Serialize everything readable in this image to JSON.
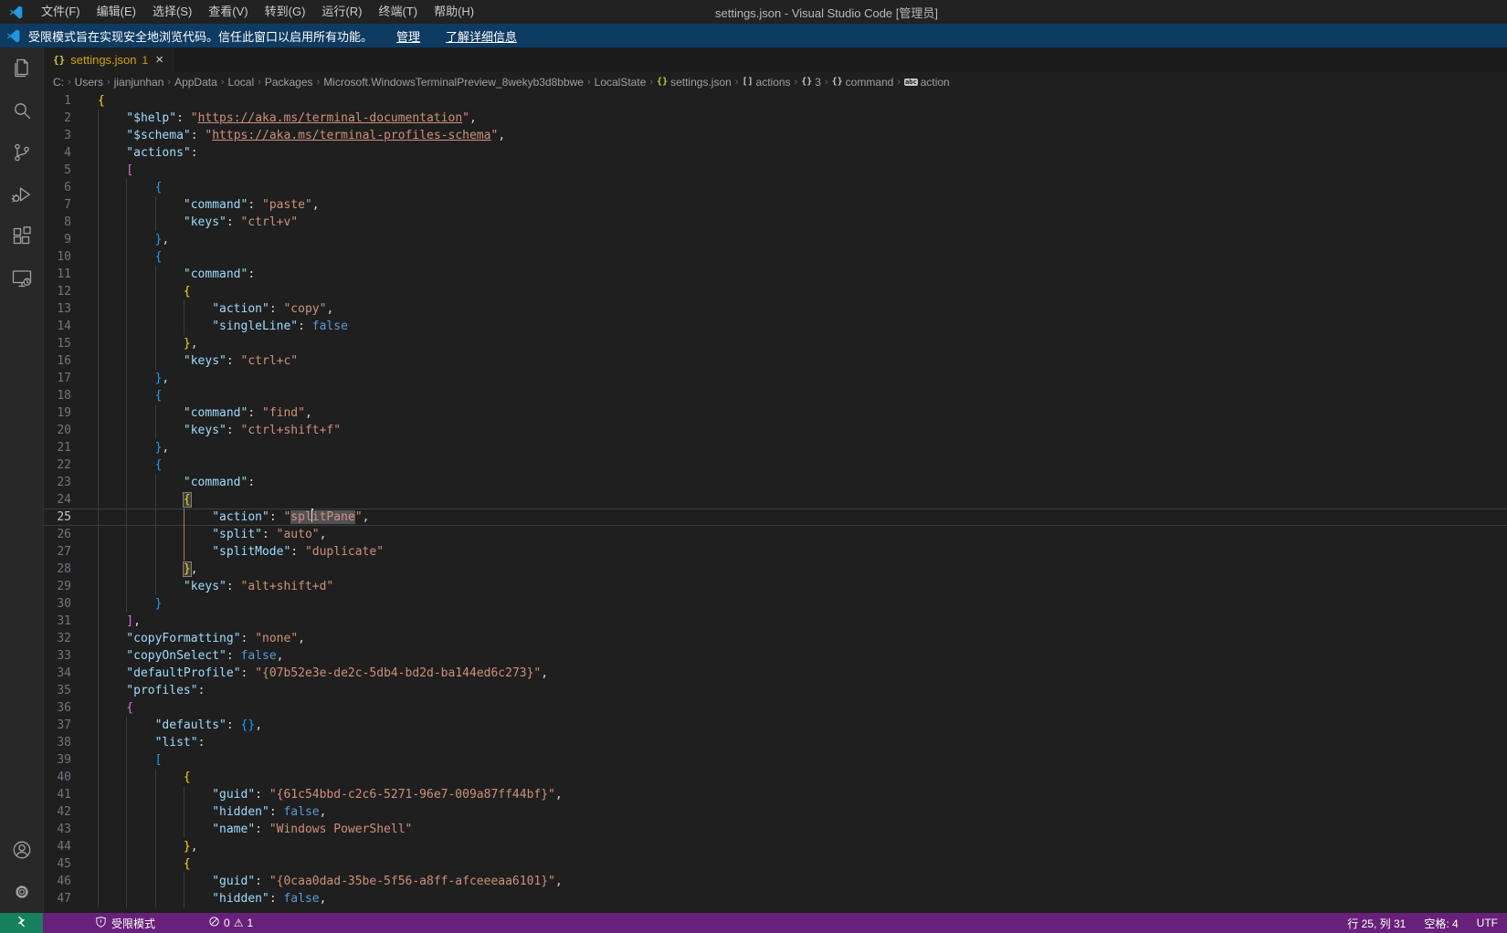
{
  "window": {
    "title": "settings.json - Visual Studio Code [管理员]"
  },
  "menus": [
    {
      "name": "file",
      "label": "文件(F)"
    },
    {
      "name": "edit",
      "label": "编辑(E)"
    },
    {
      "name": "selection",
      "label": "选择(S)"
    },
    {
      "name": "view",
      "label": "查看(V)"
    },
    {
      "name": "go",
      "label": "转到(G)"
    },
    {
      "name": "run",
      "label": "运行(R)"
    },
    {
      "name": "terminal",
      "label": "终端(T)"
    },
    {
      "name": "help",
      "label": "帮助(H)"
    }
  ],
  "banner": {
    "message": "受限模式旨在实现安全地浏览代码。信任此窗口以启用所有功能。",
    "manage_label": "管理",
    "learn_more_label": "了解详细信息"
  },
  "tab": {
    "icon_text": "{}",
    "label": "settings.json",
    "warning_badge": "1",
    "close_glyph": "×"
  },
  "breadcrumb": {
    "items": [
      {
        "label": "C:"
      },
      {
        "label": "Users"
      },
      {
        "label": "jianjunhan"
      },
      {
        "label": "AppData"
      },
      {
        "label": "Local"
      },
      {
        "label": "Packages"
      },
      {
        "label": "Microsoft.WindowsTerminalPreview_8wekyb3d8bbwe"
      },
      {
        "label": "LocalState"
      },
      {
        "label": "settings.json",
        "icon": "json-file-icon",
        "icon_text": "{}",
        "icon_class": "ic-gold"
      },
      {
        "label": "actions",
        "icon": "array-symbol-icon",
        "icon_text": "[]",
        "icon_class": "ic-gray"
      },
      {
        "label": "3",
        "icon": "object-symbol-icon",
        "icon_text": "{}",
        "icon_class": "ic-gray"
      },
      {
        "label": "command",
        "icon": "object-symbol-icon",
        "icon_text": "{}",
        "icon_class": "ic-gray"
      },
      {
        "label": "action",
        "icon": "string-symbol-icon",
        "icon_text": "abc",
        "icon_class": "ic-abc"
      }
    ]
  },
  "activity_bar": {
    "top": [
      {
        "name": "explorer"
      },
      {
        "name": "search"
      },
      {
        "name": "source-control"
      },
      {
        "name": "run-debug"
      },
      {
        "name": "extensions"
      },
      {
        "name": "remote-explorer"
      }
    ],
    "bottom": [
      {
        "name": "account"
      },
      {
        "name": "settings"
      }
    ]
  },
  "editor": {
    "cursor": {
      "line": 25,
      "col": 31
    },
    "lines": [
      {
        "n": 1,
        "t": [
          [
            "{",
            "b1"
          ]
        ]
      },
      {
        "n": 2,
        "t": [
          [
            "    ",
            ""
          ],
          [
            "\"$help\"",
            "key"
          ],
          [
            ":",
            "pn"
          ],
          [
            " ",
            ""
          ],
          [
            "\"",
            "str"
          ],
          [
            "https://aka.ms/terminal-documentation",
            "str lnk"
          ],
          [
            "\"",
            "str"
          ],
          [
            ",",
            "pn"
          ]
        ]
      },
      {
        "n": 3,
        "t": [
          [
            "    ",
            ""
          ],
          [
            "\"$schema\"",
            "key"
          ],
          [
            ":",
            "pn"
          ],
          [
            " ",
            ""
          ],
          [
            "\"",
            "str"
          ],
          [
            "https://aka.ms/terminal-profiles-schema",
            "str lnk"
          ],
          [
            "\"",
            "str"
          ],
          [
            ",",
            "pn"
          ]
        ]
      },
      {
        "n": 4,
        "t": [
          [
            "    ",
            ""
          ],
          [
            "\"actions\"",
            "key"
          ],
          [
            ":",
            "pn"
          ]
        ]
      },
      {
        "n": 5,
        "t": [
          [
            "    ",
            ""
          ],
          [
            "[",
            "b2"
          ]
        ]
      },
      {
        "n": 6,
        "t": [
          [
            "        ",
            ""
          ],
          [
            "{",
            "b3"
          ]
        ]
      },
      {
        "n": 7,
        "t": [
          [
            "            ",
            ""
          ],
          [
            "\"command\"",
            "key"
          ],
          [
            ":",
            "pn"
          ],
          [
            " ",
            ""
          ],
          [
            "\"paste\"",
            "str"
          ],
          [
            ",",
            "pn"
          ]
        ]
      },
      {
        "n": 8,
        "t": [
          [
            "            ",
            ""
          ],
          [
            "\"keys\"",
            "key"
          ],
          [
            ":",
            "pn"
          ],
          [
            " ",
            ""
          ],
          [
            "\"ctrl+v\"",
            "str"
          ]
        ]
      },
      {
        "n": 9,
        "t": [
          [
            "        ",
            ""
          ],
          [
            "}",
            "b3"
          ],
          [
            ",",
            "pn"
          ]
        ]
      },
      {
        "n": 10,
        "t": [
          [
            "        ",
            ""
          ],
          [
            "{",
            "b3"
          ]
        ]
      },
      {
        "n": 11,
        "t": [
          [
            "            ",
            ""
          ],
          [
            "\"command\"",
            "key"
          ],
          [
            ":",
            "pn"
          ]
        ]
      },
      {
        "n": 12,
        "t": [
          [
            "            ",
            ""
          ],
          [
            "{",
            "b1"
          ]
        ]
      },
      {
        "n": 13,
        "t": [
          [
            "                ",
            ""
          ],
          [
            "\"action\"",
            "key"
          ],
          [
            ":",
            "pn"
          ],
          [
            " ",
            ""
          ],
          [
            "\"copy\"",
            "str"
          ],
          [
            ",",
            "pn"
          ]
        ]
      },
      {
        "n": 14,
        "t": [
          [
            "                ",
            ""
          ],
          [
            "\"singleLine\"",
            "key"
          ],
          [
            ":",
            "pn"
          ],
          [
            " ",
            ""
          ],
          [
            "false",
            "kw"
          ]
        ]
      },
      {
        "n": 15,
        "t": [
          [
            "            ",
            ""
          ],
          [
            "}",
            "b1"
          ],
          [
            ",",
            "pn"
          ]
        ]
      },
      {
        "n": 16,
        "t": [
          [
            "            ",
            ""
          ],
          [
            "\"keys\"",
            "key"
          ],
          [
            ":",
            "pn"
          ],
          [
            " ",
            ""
          ],
          [
            "\"ctrl+c\"",
            "str"
          ]
        ]
      },
      {
        "n": 17,
        "t": [
          [
            "        ",
            ""
          ],
          [
            "}",
            "b3"
          ],
          [
            ",",
            "pn"
          ]
        ]
      },
      {
        "n": 18,
        "t": [
          [
            "        ",
            ""
          ],
          [
            "{",
            "b3"
          ]
        ]
      },
      {
        "n": 19,
        "t": [
          [
            "            ",
            ""
          ],
          [
            "\"command\"",
            "key"
          ],
          [
            ":",
            "pn"
          ],
          [
            " ",
            ""
          ],
          [
            "\"find\"",
            "str"
          ],
          [
            ",",
            "pn"
          ]
        ]
      },
      {
        "n": 20,
        "t": [
          [
            "            ",
            ""
          ],
          [
            "\"keys\"",
            "key"
          ],
          [
            ":",
            "pn"
          ],
          [
            " ",
            ""
          ],
          [
            "\"ctrl+shift+f\"",
            "str"
          ]
        ]
      },
      {
        "n": 21,
        "t": [
          [
            "        ",
            ""
          ],
          [
            "}",
            "b3"
          ],
          [
            ",",
            "pn"
          ]
        ]
      },
      {
        "n": 22,
        "t": [
          [
            "        ",
            ""
          ],
          [
            "{",
            "b3"
          ]
        ]
      },
      {
        "n": 23,
        "t": [
          [
            "            ",
            ""
          ],
          [
            "\"command\"",
            "key"
          ],
          [
            ":",
            "pn"
          ]
        ]
      },
      {
        "n": 24,
        "t": [
          [
            "            ",
            ""
          ],
          [
            "{",
            "b1 bm"
          ]
        ]
      },
      {
        "n": 25,
        "pg": 12,
        "t": [
          [
            "                ",
            ""
          ],
          [
            "\"action\"",
            "key"
          ],
          [
            ":",
            "pn"
          ],
          [
            " ",
            ""
          ],
          [
            "\"",
            "str"
          ],
          [
            "spl",
            "str hl",
            1
          ],
          [
            "itPane",
            "str hl"
          ],
          [
            "\"",
            "str"
          ],
          [
            ",",
            "pn"
          ]
        ]
      },
      {
        "n": 26,
        "pg": 12,
        "t": [
          [
            "                ",
            ""
          ],
          [
            "\"split\"",
            "key"
          ],
          [
            ":",
            "pn"
          ],
          [
            " ",
            ""
          ],
          [
            "\"auto\"",
            "str"
          ],
          [
            ",",
            "pn"
          ]
        ]
      },
      {
        "n": 27,
        "pg": 12,
        "t": [
          [
            "                ",
            ""
          ],
          [
            "\"splitMode\"",
            "key"
          ],
          [
            ":",
            "pn"
          ],
          [
            " ",
            ""
          ],
          [
            "\"duplicate\"",
            "str"
          ]
        ]
      },
      {
        "n": 28,
        "t": [
          [
            "            ",
            ""
          ],
          [
            "}",
            "b1 bm"
          ],
          [
            ",",
            "pn"
          ]
        ]
      },
      {
        "n": 29,
        "t": [
          [
            "            ",
            ""
          ],
          [
            "\"keys\"",
            "key"
          ],
          [
            ":",
            "pn"
          ],
          [
            " ",
            ""
          ],
          [
            "\"alt+shift+d\"",
            "str"
          ]
        ]
      },
      {
        "n": 30,
        "t": [
          [
            "        ",
            ""
          ],
          [
            "}",
            "b3"
          ]
        ]
      },
      {
        "n": 31,
        "t": [
          [
            "    ",
            ""
          ],
          [
            "]",
            "b2"
          ],
          [
            ",",
            "pn"
          ]
        ]
      },
      {
        "n": 32,
        "t": [
          [
            "    ",
            ""
          ],
          [
            "\"copyFormatting\"",
            "key"
          ],
          [
            ":",
            "pn"
          ],
          [
            " ",
            ""
          ],
          [
            "\"none\"",
            "str"
          ],
          [
            ",",
            "pn"
          ]
        ]
      },
      {
        "n": 33,
        "t": [
          [
            "    ",
            ""
          ],
          [
            "\"copyOnSelect\"",
            "key"
          ],
          [
            ":",
            "pn"
          ],
          [
            " ",
            ""
          ],
          [
            "false",
            "kw"
          ],
          [
            ",",
            "pn"
          ]
        ]
      },
      {
        "n": 34,
        "t": [
          [
            "    ",
            ""
          ],
          [
            "\"defaultProfile\"",
            "key"
          ],
          [
            ":",
            "pn"
          ],
          [
            " ",
            ""
          ],
          [
            "\"{07b52e3e-de2c-5db4-bd2d-ba144ed6c273}\"",
            "str"
          ],
          [
            ",",
            "pn"
          ]
        ]
      },
      {
        "n": 35,
        "t": [
          [
            "    ",
            ""
          ],
          [
            "\"profiles\"",
            "key"
          ],
          [
            ":",
            "pn"
          ]
        ]
      },
      {
        "n": 36,
        "t": [
          [
            "    ",
            ""
          ],
          [
            "{",
            "b2"
          ]
        ]
      },
      {
        "n": 37,
        "t": [
          [
            "        ",
            ""
          ],
          [
            "\"defaults\"",
            "key"
          ],
          [
            ":",
            "pn"
          ],
          [
            " ",
            ""
          ],
          [
            "{}",
            "b3"
          ],
          [
            ",",
            "pn"
          ]
        ]
      },
      {
        "n": 38,
        "t": [
          [
            "        ",
            ""
          ],
          [
            "\"list\"",
            "key"
          ],
          [
            ":",
            "pn"
          ]
        ]
      },
      {
        "n": 39,
        "t": [
          [
            "        ",
            ""
          ],
          [
            "[",
            "b3"
          ]
        ]
      },
      {
        "n": 40,
        "t": [
          [
            "            ",
            ""
          ],
          [
            "{",
            "b1"
          ]
        ]
      },
      {
        "n": 41,
        "t": [
          [
            "                ",
            ""
          ],
          [
            "\"guid\"",
            "key"
          ],
          [
            ":",
            "pn"
          ],
          [
            " ",
            ""
          ],
          [
            "\"{61c54bbd-c2c6-5271-96e7-009a87ff44bf}\"",
            "str"
          ],
          [
            ",",
            "pn"
          ]
        ]
      },
      {
        "n": 42,
        "t": [
          [
            "                ",
            ""
          ],
          [
            "\"hidden\"",
            "key"
          ],
          [
            ":",
            "pn"
          ],
          [
            " ",
            ""
          ],
          [
            "false",
            "kw"
          ],
          [
            ",",
            "pn"
          ]
        ]
      },
      {
        "n": 43,
        "t": [
          [
            "                ",
            ""
          ],
          [
            "\"name\"",
            "key"
          ],
          [
            ":",
            "pn"
          ],
          [
            " ",
            ""
          ],
          [
            "\"Windows PowerShell\"",
            "str"
          ]
        ]
      },
      {
        "n": 44,
        "t": [
          [
            "            ",
            ""
          ],
          [
            "}",
            "b1"
          ],
          [
            ",",
            "pn"
          ]
        ]
      },
      {
        "n": 45,
        "t": [
          [
            "            ",
            ""
          ],
          [
            "{",
            "b1"
          ]
        ]
      },
      {
        "n": 46,
        "t": [
          [
            "                ",
            ""
          ],
          [
            "\"guid\"",
            "key"
          ],
          [
            ":",
            "pn"
          ],
          [
            " ",
            ""
          ],
          [
            "\"{0caa0dad-35be-5f56-a8ff-afceeeaa6101}\"",
            "str"
          ],
          [
            ",",
            "pn"
          ]
        ]
      },
      {
        "n": 47,
        "t": [
          [
            "                ",
            ""
          ],
          [
            "\"hidden\"",
            "key"
          ],
          [
            ":",
            "pn"
          ],
          [
            " ",
            ""
          ],
          [
            "false",
            "kw"
          ],
          [
            ",",
            "pn"
          ]
        ]
      }
    ]
  },
  "status_bar": {
    "restricted_label": "受限模式",
    "errors": "0",
    "warnings": "1",
    "warning_glyph": "⚠",
    "line_col": "行 25, 列 31",
    "indent_label": "空格: 4",
    "encoding": "UTF"
  },
  "colors": {
    "status_bar_bg": "#68217A",
    "remote_bg": "#16825D",
    "banner_bg": "#0E3B61",
    "warning_fg": "#CCA700",
    "editor_bg": "#1F1F1F"
  }
}
